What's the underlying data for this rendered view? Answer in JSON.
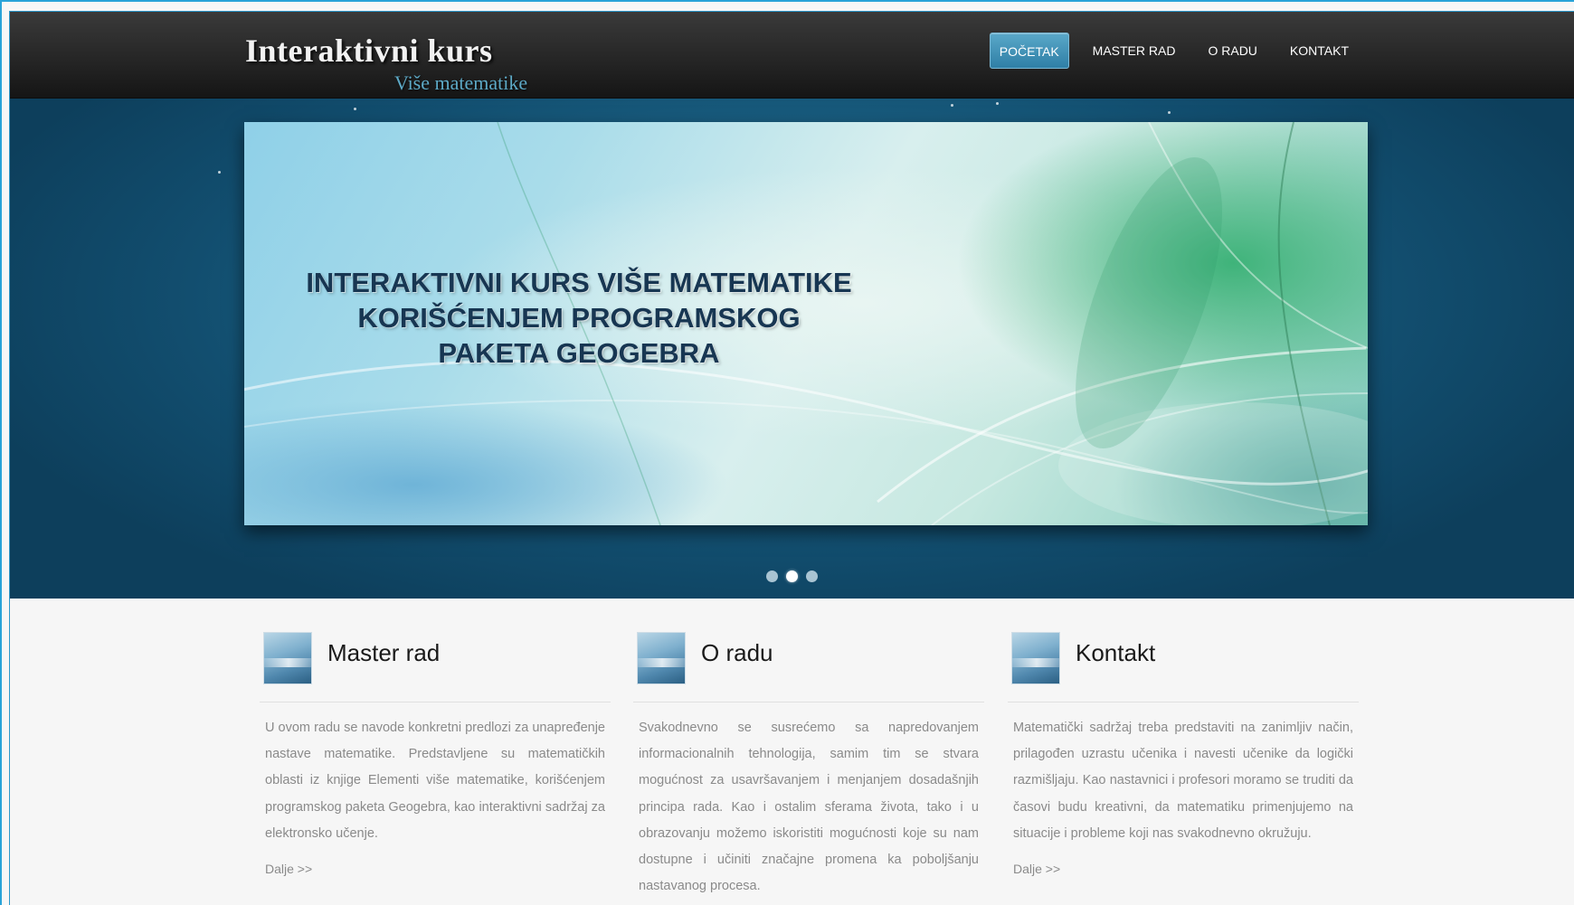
{
  "header": {
    "logo_title": "Interaktivni kurs",
    "logo_subtitle": "Više matematike",
    "nav": [
      {
        "label": "POČETAK",
        "active": true
      },
      {
        "label": "MASTER RAD",
        "active": false
      },
      {
        "label": "O RADU",
        "active": false
      },
      {
        "label": "KONTAKT",
        "active": false
      }
    ]
  },
  "slider": {
    "lines": [
      "INTERAKTIVNI KURS VIŠE MATEMATIKE",
      "KORIŠĆENJEM PROGRAMSKOG",
      "PAKETA GEOGEBRA"
    ],
    "dot_count": 3,
    "active_dot": 2
  },
  "columns": [
    {
      "title": "Master rad",
      "body": "U ovom radu se navode konkretni predlozi za unapređenje nastave matematike. Predstavljene su matematičkih oblasti iz knjige Elementi više matematike, korišćenjem programskog paketa Geogebra, kao interaktivni sadržaj za elektronsko učenje.",
      "more": "Dalje >>"
    },
    {
      "title": "O radu",
      "body": "Svakodnevno se susrećemo sa napredovanjem informacionalnih tehnologija, samim tim se stvara mogućnost za usavršavanjem i menjanjem dosadašnjih principa rada. Kao i ostalim sferama života, tako i u obrazovanju možemo iskoristiti mogućnosti koje su nam dostupne i učiniti značajne promena ka poboljšanju nastavanog procesa.",
      "more": ""
    },
    {
      "title": "Kontakt",
      "body": "Matematički sadržaj treba predstaviti na zanimljiv način, prilagođen uzrastu učenika i navesti učenike da logički razmišljaju. Kao nastavnici i profesori moramo se truditi da časovi budu kreativni, da matematiku primenjujemo na situacije i probleme koji nas svakodnevno okružuju.",
      "more": "Dalje >>"
    }
  ],
  "colors": {
    "accent": "#2f7fa6",
    "frame": "#29a3d8",
    "header_bg": "#262626",
    "slider_bg": "#1d6689",
    "body_text": "#8a8a8a"
  }
}
